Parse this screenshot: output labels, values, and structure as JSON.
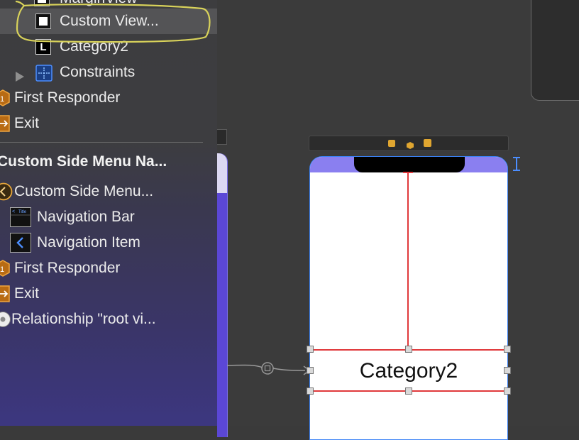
{
  "outline": {
    "items": [
      {
        "label": "MarginView",
        "icon": "view-icon"
      },
      {
        "label": "Custom View...",
        "icon": "view-icon",
        "selected": true
      },
      {
        "label": "Category2",
        "icon": "label-icon"
      },
      {
        "label": "Constraints",
        "icon": "constraints-icon"
      },
      {
        "label": "First Responder",
        "icon": "first-responder-icon"
      },
      {
        "label": "Exit",
        "icon": "exit-icon"
      }
    ],
    "label_glyph": "L",
    "section_title": "Custom Side Menu Na...",
    "section_items": [
      {
        "label": "Custom Side Menu...",
        "icon": "back-circle-icon"
      },
      {
        "label": "Navigation Bar",
        "icon": "navigation-bar-icon"
      },
      {
        "label": "Navigation Item",
        "icon": "navigation-item-icon"
      },
      {
        "label": "First Responder",
        "icon": "first-responder-icon"
      },
      {
        "label": "Exit",
        "icon": "exit-icon"
      },
      {
        "label": "Relationship \"root vi...",
        "icon": "relationship-icon"
      }
    ]
  },
  "canvas": {
    "label_text": "Category2",
    "accent": "#8a7ff0",
    "constraint_color": "#e0383b"
  }
}
